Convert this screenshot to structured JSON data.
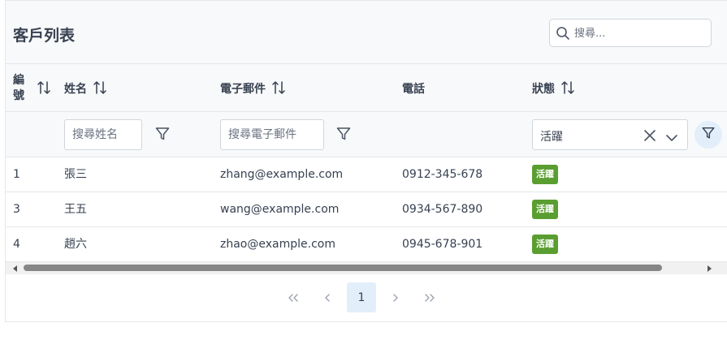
{
  "header": {
    "title": "客戶列表",
    "search_placeholder": "搜尋..."
  },
  "columns": {
    "id": "編號",
    "name": "姓名",
    "email": "電子郵件",
    "phone": "電話",
    "status": "狀態"
  },
  "filters": {
    "name_placeholder": "搜尋姓名",
    "email_placeholder": "搜尋電子郵件",
    "status_value": "活躍"
  },
  "rows": [
    {
      "id": "1",
      "name": "張三",
      "email": "zhang@example.com",
      "phone": "0912-345-678",
      "status": "活躍"
    },
    {
      "id": "3",
      "name": "王五",
      "email": "wang@example.com",
      "phone": "0934-567-890",
      "status": "活躍"
    },
    {
      "id": "4",
      "name": "趙六",
      "email": "zhao@example.com",
      "phone": "0945-678-901",
      "status": "活躍"
    }
  ],
  "pagination": {
    "current_page": "1"
  },
  "colors": {
    "status_active": "#5a9e31",
    "page_active_bg": "#e3eefb"
  },
  "icons": [
    "search-icon",
    "sort-icon",
    "filter-icon",
    "clear-icon",
    "chevron-down-icon",
    "first-page-icon",
    "prev-page-icon",
    "next-page-icon",
    "last-page-icon"
  ]
}
